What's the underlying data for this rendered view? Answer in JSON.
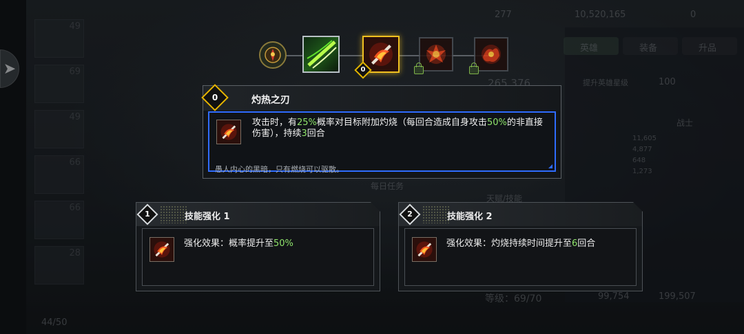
{
  "skill_chain": {
    "nodes": [
      {
        "name": "passive-emblem",
        "state": "unlocked"
      },
      {
        "name": "wind-slash-skill",
        "state": "unlocked"
      },
      {
        "name": "burning-blade-skill",
        "state": "selected",
        "level": "0"
      },
      {
        "name": "fire-burst-skill",
        "state": "locked"
      },
      {
        "name": "fire-storm-skill",
        "state": "locked"
      }
    ]
  },
  "tooltip": {
    "level": "0",
    "title": "灼热之刃",
    "desc_parts": [
      "攻击时，有",
      "25%",
      "概率对目标附加灼烧（每回合造成自身攻击",
      "50%",
      "的非直接伤害），持续",
      "3",
      "回合"
    ],
    "flavor": "愚人内心的黑暗，只有燃烧可以驱散。"
  },
  "enhancements": [
    {
      "num": "1",
      "title": "技能强化 1",
      "effect_prefix": "强化效果：概率提升至",
      "effect_value": "50%",
      "effect_suffix": ""
    },
    {
      "num": "2",
      "title": "技能强化 2",
      "effect_prefix": "强化效果：灼烧持续时间提升至",
      "effect_value": "6",
      "effect_suffix": "回合"
    }
  ],
  "background": {
    "top_stats": [
      "277",
      "10,520,165",
      "0"
    ],
    "tabs": [
      "英雄",
      "装备",
      "升品"
    ],
    "power": "265,376",
    "upgrade_label": "提升英雄星级",
    "upgrade_cost": "100",
    "role": "战士",
    "stats_bars": [
      "11,605",
      "4,877",
      "648",
      "1,273"
    ],
    "daily_task": "每日任务",
    "talent_skill": "天赋/技能",
    "level_text": "等级：69/70",
    "cost_gold": "99,754",
    "cost_total": "199,507",
    "roster_count": "44/50",
    "hero_levels": [
      "49",
      "69",
      "49",
      "66",
      "66",
      "28"
    ]
  },
  "colors": {
    "highlight_green": "#8fe36b",
    "gold_border": "#f0c020",
    "blue_border": "#2f6cff"
  }
}
